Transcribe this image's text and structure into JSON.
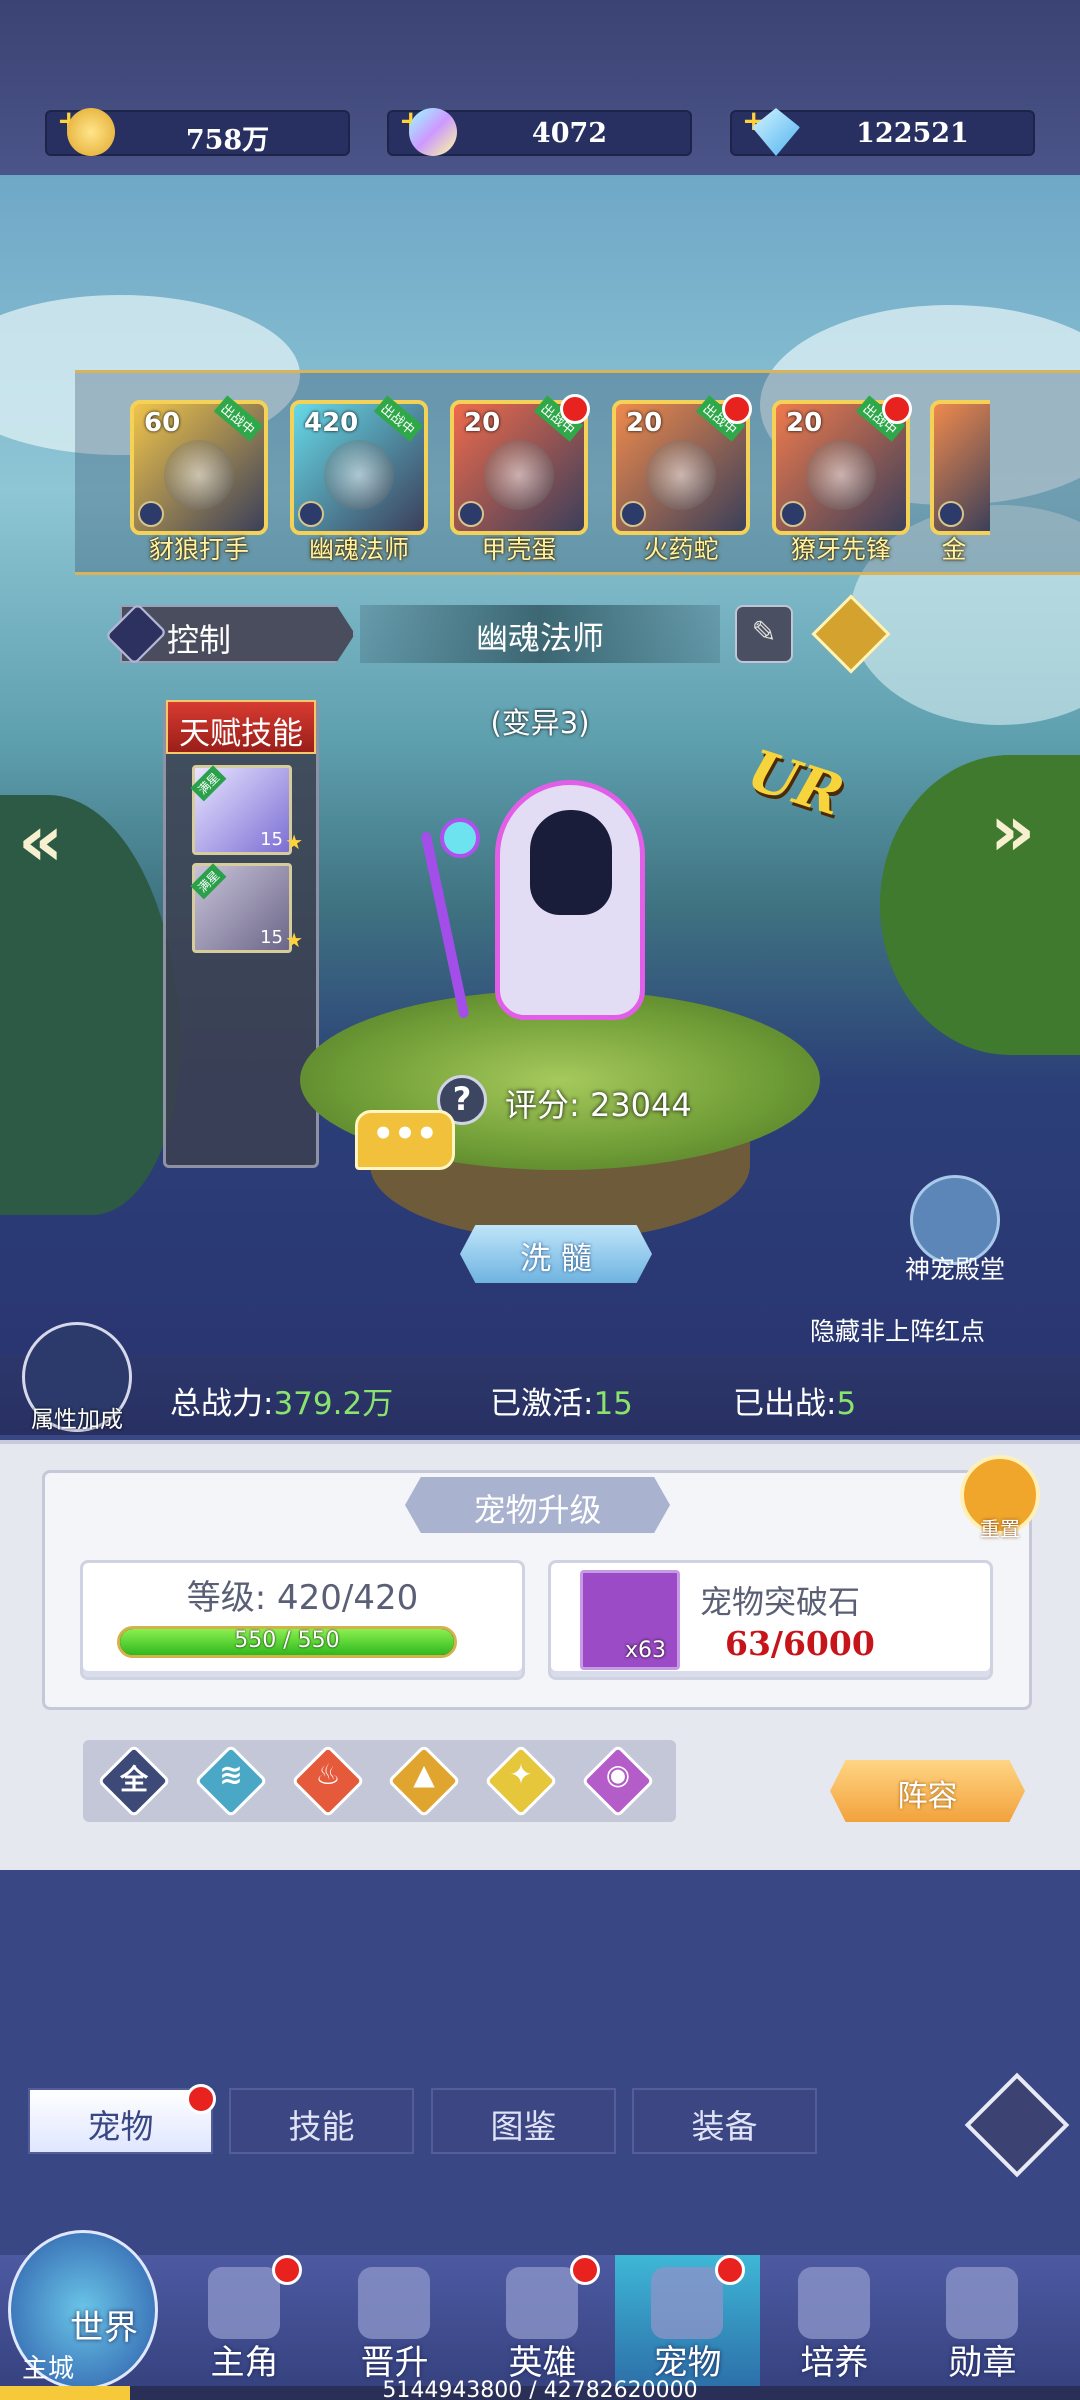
{
  "currencies": [
    {
      "name": "gold-coin-icon",
      "value": "758万",
      "color": "#f3c23b"
    },
    {
      "name": "rainbow-crystal-icon",
      "value": "4072",
      "color": "#c6a8ff"
    },
    {
      "name": "diamond-icon",
      "value": "122521",
      "color": "#6fd0ff"
    }
  ],
  "pets_strip": [
    {
      "level": "60",
      "name": "豺狼打手",
      "fighting": "出战中",
      "color": "#f0c44a"
    },
    {
      "level": "420",
      "name": "幽魂法师",
      "fighting": "出战中",
      "color": "#66d9e8"
    },
    {
      "level": "20",
      "name": "甲壳蛋",
      "fighting": "出战中",
      "color": "#ef6a4c"
    },
    {
      "level": "20",
      "name": "火药蛇",
      "fighting": "出战中",
      "color": "#ef8a4c"
    },
    {
      "level": "20",
      "name": "獠牙先锋",
      "fighting": "出战中",
      "color": "#ef7a4c"
    },
    {
      "level": "",
      "name": "金",
      "fighting": "",
      "color": "#ef8a4c"
    }
  ],
  "pet": {
    "type_label": "控制",
    "name": "幽魂法师",
    "variant": "(变异3)",
    "rarity": "UR",
    "score_label": "评分: 23044",
    "chat": "•••",
    "xisui_button": "洗 髓",
    "edit_icon": "quill-icon"
  },
  "talent": {
    "title": "天赋技能",
    "skills": [
      {
        "tag": "满星",
        "level": "15"
      },
      {
        "tag": "满星",
        "level": "15"
      }
    ]
  },
  "shrine_label": "神宠殿堂",
  "hide_red_dots": "隐藏非上阵红点",
  "attr_bonus": "属性加成",
  "stats": {
    "power_label": "总战力:",
    "power": "379.2万",
    "activated_label": "已激活:",
    "activated": "15",
    "fielded_label": "已出战:",
    "fielded": "5"
  },
  "upgrade": {
    "title": "宠物升级",
    "reset": "重置",
    "level_text": "等级: 420/420",
    "exp_text": "550 / 550",
    "exp_fraction": 1.0,
    "stone_name": "宠物突破石",
    "stone_count": "x63",
    "stone_qty": "63/6000"
  },
  "filters": [
    {
      "icon": "全",
      "color": "#3d4a78"
    },
    {
      "icon": "≋",
      "color": "#4aa8c6"
    },
    {
      "icon": "♨",
      "color": "#e45a3a"
    },
    {
      "icon": "▲",
      "color": "#e0a52e"
    },
    {
      "icon": "✦",
      "color": "#e6c63a"
    },
    {
      "icon": "◉",
      "color": "#b45cc8"
    }
  ],
  "lineup_button": "阵容",
  "tabs": [
    "宠物",
    "技能",
    "图鉴",
    "装备"
  ],
  "nav": {
    "world": "世界",
    "world_sub": "主城",
    "items": [
      "主角",
      "晋升",
      "英雄",
      "宠物",
      "培养",
      "勋章"
    ]
  },
  "progress_text": "5144943800 / 42782620000"
}
